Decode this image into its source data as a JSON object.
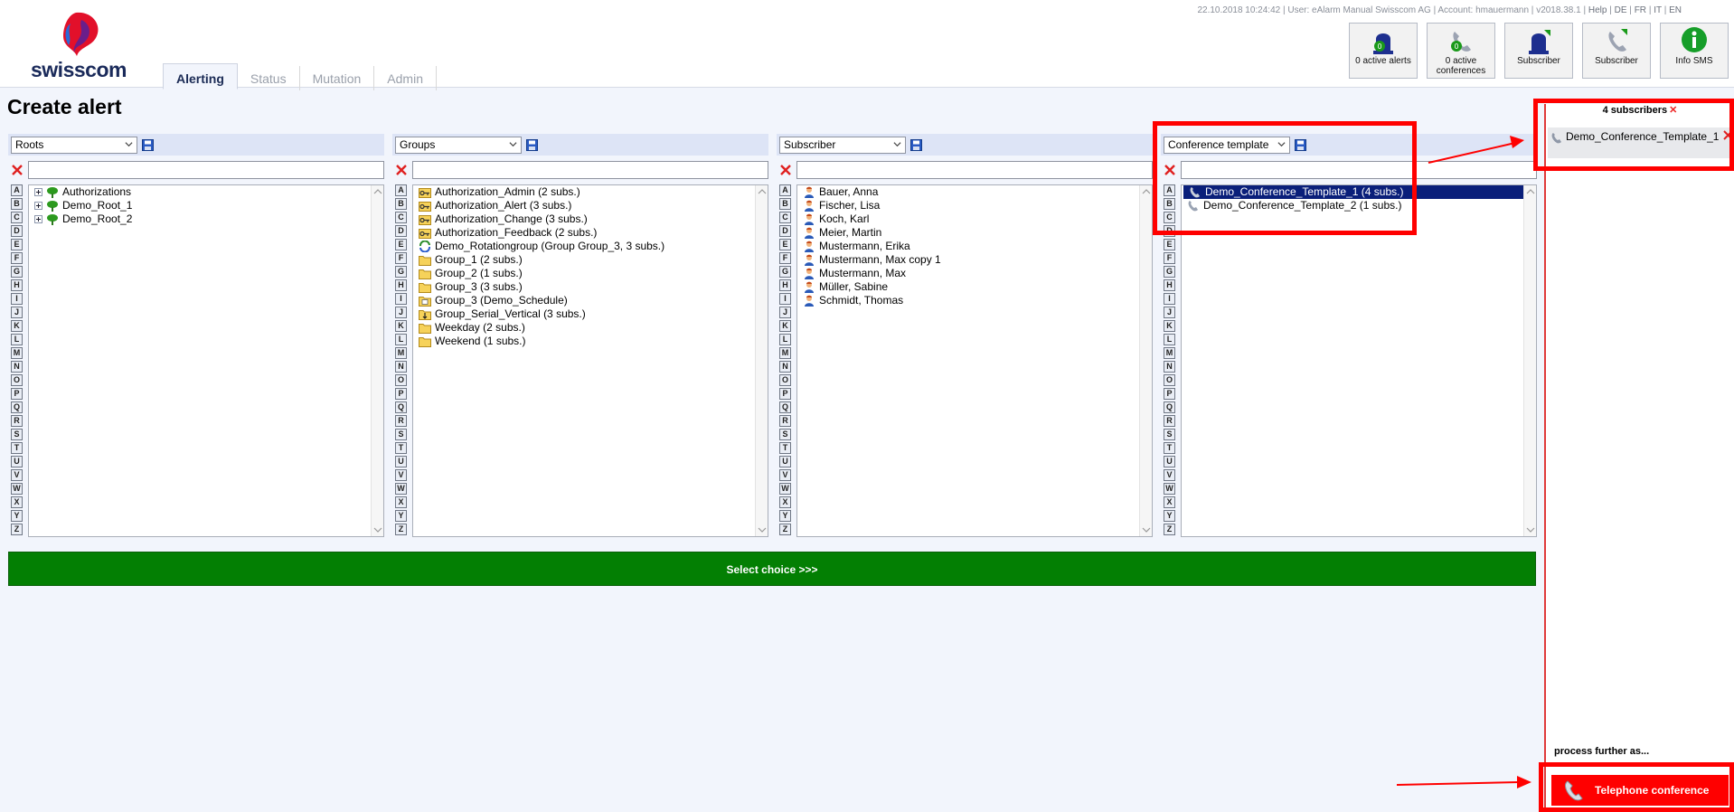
{
  "header": {
    "logo_text": "swisscom",
    "meta": {
      "timestamp": "22.10.2018 10:24:42",
      "user": "User: eAlarm Manual Swisscom AG",
      "account": "Account: hmauermann",
      "version": "v2018.38.1",
      "help": "Help",
      "lang": [
        "DE",
        "FR",
        "IT",
        "EN"
      ]
    },
    "tabs": [
      {
        "label": "Alerting"
      },
      {
        "label": "Status"
      },
      {
        "label": "Mutation"
      },
      {
        "label": "Admin"
      }
    ],
    "quick_buttons": [
      {
        "label": "0 active alerts",
        "icon": "active-alerts-siren-icon",
        "badge": "0"
      },
      {
        "label": "0 active conferences",
        "icon": "active-conferences-phone-icon",
        "badge": "0"
      },
      {
        "label": "Subscriber",
        "icon": "subscriber-siren-icon"
      },
      {
        "label": "Subscriber",
        "icon": "subscriber-phone-icon"
      },
      {
        "label": "Info SMS",
        "icon": "info-icon"
      }
    ]
  },
  "page": {
    "title": "Create alert"
  },
  "alphabet": [
    "A",
    "B",
    "C",
    "D",
    "E",
    "F",
    "G",
    "H",
    "I",
    "J",
    "K",
    "L",
    "M",
    "N",
    "O",
    "P",
    "Q",
    "R",
    "S",
    "T",
    "U",
    "V",
    "W",
    "X",
    "Y",
    "Z"
  ],
  "columns": {
    "roots": {
      "select": "Roots",
      "filter_value": "",
      "items": [
        {
          "label": "Authorizations",
          "icon": "tree-node-icon"
        },
        {
          "label": "Demo_Root_1",
          "icon": "tree-node-icon"
        },
        {
          "label": "Demo_Root_2",
          "icon": "tree-node-icon"
        }
      ]
    },
    "groups": {
      "select": "Groups",
      "filter_value": "",
      "items": [
        {
          "label": "Authorization_Admin (2 subs.)",
          "icon": "key-folder-icon"
        },
        {
          "label": "Authorization_Alert (3 subs.)",
          "icon": "key-folder-icon"
        },
        {
          "label": "Authorization_Change (3 subs.)",
          "icon": "key-folder-icon"
        },
        {
          "label": "Authorization_Feedback (2 subs.)",
          "icon": "key-folder-icon"
        },
        {
          "label": "Demo_Rotationgroup (Group Group_3, 3 subs.)",
          "icon": "rotation-icon"
        },
        {
          "label": "Group_1 (2 subs.)",
          "icon": "folder-icon"
        },
        {
          "label": "Group_2 (1 subs.)",
          "icon": "folder-icon"
        },
        {
          "label": "Group_3 (3 subs.)",
          "icon": "folder-icon"
        },
        {
          "label": "Group_3 (Demo_Schedule)",
          "icon": "schedule-folder-icon"
        },
        {
          "label": "Group_Serial_Vertical (3 subs.)",
          "icon": "serial-folder-icon"
        },
        {
          "label": "Weekday (2 subs.)",
          "icon": "folder-icon"
        },
        {
          "label": "Weekend (1 subs.)",
          "icon": "folder-icon"
        }
      ]
    },
    "subscriber": {
      "select": "Subscriber",
      "filter_value": "",
      "items": [
        {
          "label": "Bauer, Anna"
        },
        {
          "label": "Fischer, Lisa"
        },
        {
          "label": "Koch, Karl"
        },
        {
          "label": "Meier, Martin"
        },
        {
          "label": "Mustermann, Erika"
        },
        {
          "label": "Mustermann, Max copy 1"
        },
        {
          "label": "Mustermann, Max"
        },
        {
          "label": "Müller, Sabine"
        },
        {
          "label": "Schmidt, Thomas"
        }
      ]
    },
    "conference": {
      "select": "Conference template",
      "filter_value": "",
      "items": [
        {
          "label": "Demo_Conference_Template_1 (4 subs.)",
          "selected": true
        },
        {
          "label": "Demo_Conference_Template_2 (1 subs.)",
          "selected": false
        }
      ]
    }
  },
  "select_choice_label": "Select choice >>>",
  "right_panel": {
    "count_label": "4 subscribers",
    "item_label": "Demo_Conference_Template_1",
    "process_label": "process further as...",
    "tel_conf_label": "Telephone conference"
  },
  "colors": {
    "green_button": "#037f03",
    "selected_row": "#0a1f7a",
    "annotation_red": "#ff0000",
    "header_blue": "#dde4f6"
  }
}
